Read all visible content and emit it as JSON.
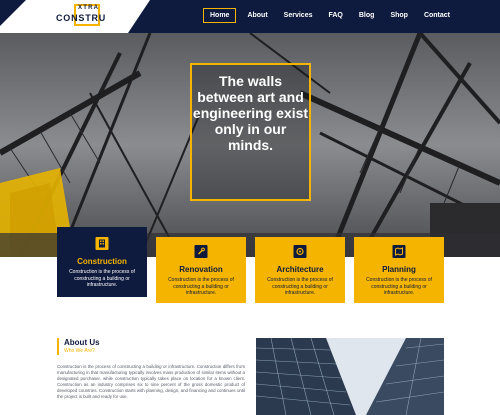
{
  "brand": {
    "logo_top": "XTRA",
    "logo_main": "CONSTRU"
  },
  "nav": {
    "items": [
      {
        "label": "Home"
      },
      {
        "label": "About"
      },
      {
        "label": "Services"
      },
      {
        "label": "FAQ"
      },
      {
        "label": "Blog"
      },
      {
        "label": "Shop"
      },
      {
        "label": "Contact"
      }
    ],
    "active": "Home"
  },
  "hero": {
    "headline": "The walls between art and engineering exist only in our minds."
  },
  "services": [
    {
      "title": "Construction",
      "text": "Construction is the process of constructing a building or infrastructure.",
      "icon": "building-icon",
      "highlight": true
    },
    {
      "title": "Renovation",
      "text": "Construction is the process of constructing a building or infrastructure.",
      "icon": "wrench-icon",
      "highlight": false
    },
    {
      "title": "Architecture",
      "text": "Construction is the process of constructing a building or infrastructure.",
      "icon": "gear-icon",
      "highlight": false
    },
    {
      "title": "Planning",
      "text": "Construction is the process of constructing a building or infrastructure.",
      "icon": "map-icon",
      "highlight": false
    }
  ],
  "about": {
    "title": "About Us",
    "subtitle": "Who We Are?",
    "text": "Construction is the process of constructing a building or infrastructure. Construction differs from manufacturing in that manufacturing typically involves mass production of similar items without a designated purchaser, while construction typically takes place on location for a known client. Construction as an industry comprises six to nine percent of the gross domestic product of developed countries. Construction starts with planning, design, and financing and continues until the project is built and ready for use."
  },
  "colors": {
    "navy": "#0f1b3e",
    "accent": "#f4b400",
    "white": "#ffffff"
  }
}
